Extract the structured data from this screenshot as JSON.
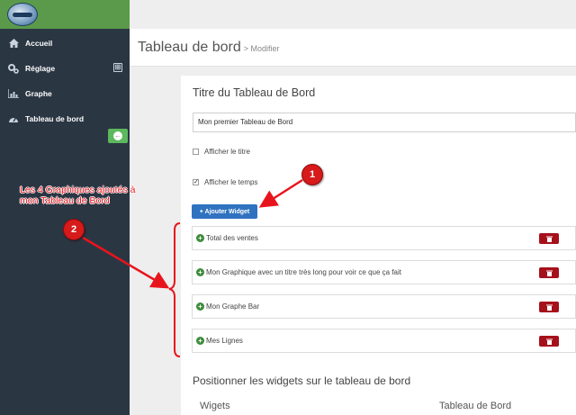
{
  "sidebar": {
    "items": [
      {
        "label": "Accueil",
        "icon": "home-icon"
      },
      {
        "label": "Réglage",
        "icon": "gears-icon",
        "expand": "⊞"
      },
      {
        "label": "Graphe",
        "icon": "chart-icon"
      },
      {
        "label": "Tableau de bord",
        "icon": "dashboard-icon"
      }
    ]
  },
  "header": {
    "title": "Tableau de bord",
    "subtitle": "> Modifier"
  },
  "form": {
    "title": "Titre du Tableau de Bord",
    "title_value": "Mon premier Tableau de Bord",
    "show_title_label": "Afficher le titre",
    "show_title_checked": false,
    "show_time_label": "Afficher le temps",
    "show_time_checked": true,
    "add_widget_label": "+ Ajouter Widget"
  },
  "widgets": [
    "Total des ventes",
    "Mon Graphique avec un titre très long pour voir ce que ça fait",
    "Mon Graphe Bar",
    "Mes Lignes"
  ],
  "position_section": {
    "title": "Positionner les widgets sur le tableau de bord",
    "col_left": "Wigets",
    "col_right": "Tableau de Bord"
  },
  "annotations": {
    "text": "Les 4 Graphiques ajoutés à mon Tableau de Bord",
    "badge1": "1",
    "badge2": "2",
    "color": "#e8141c"
  },
  "colors": {
    "sidebar": "#2b3643",
    "logo_bar": "#5a9a4a",
    "add_button": "#2f72c0",
    "delete_button": "#a6101b",
    "add_icon": "#3c8b3c"
  }
}
